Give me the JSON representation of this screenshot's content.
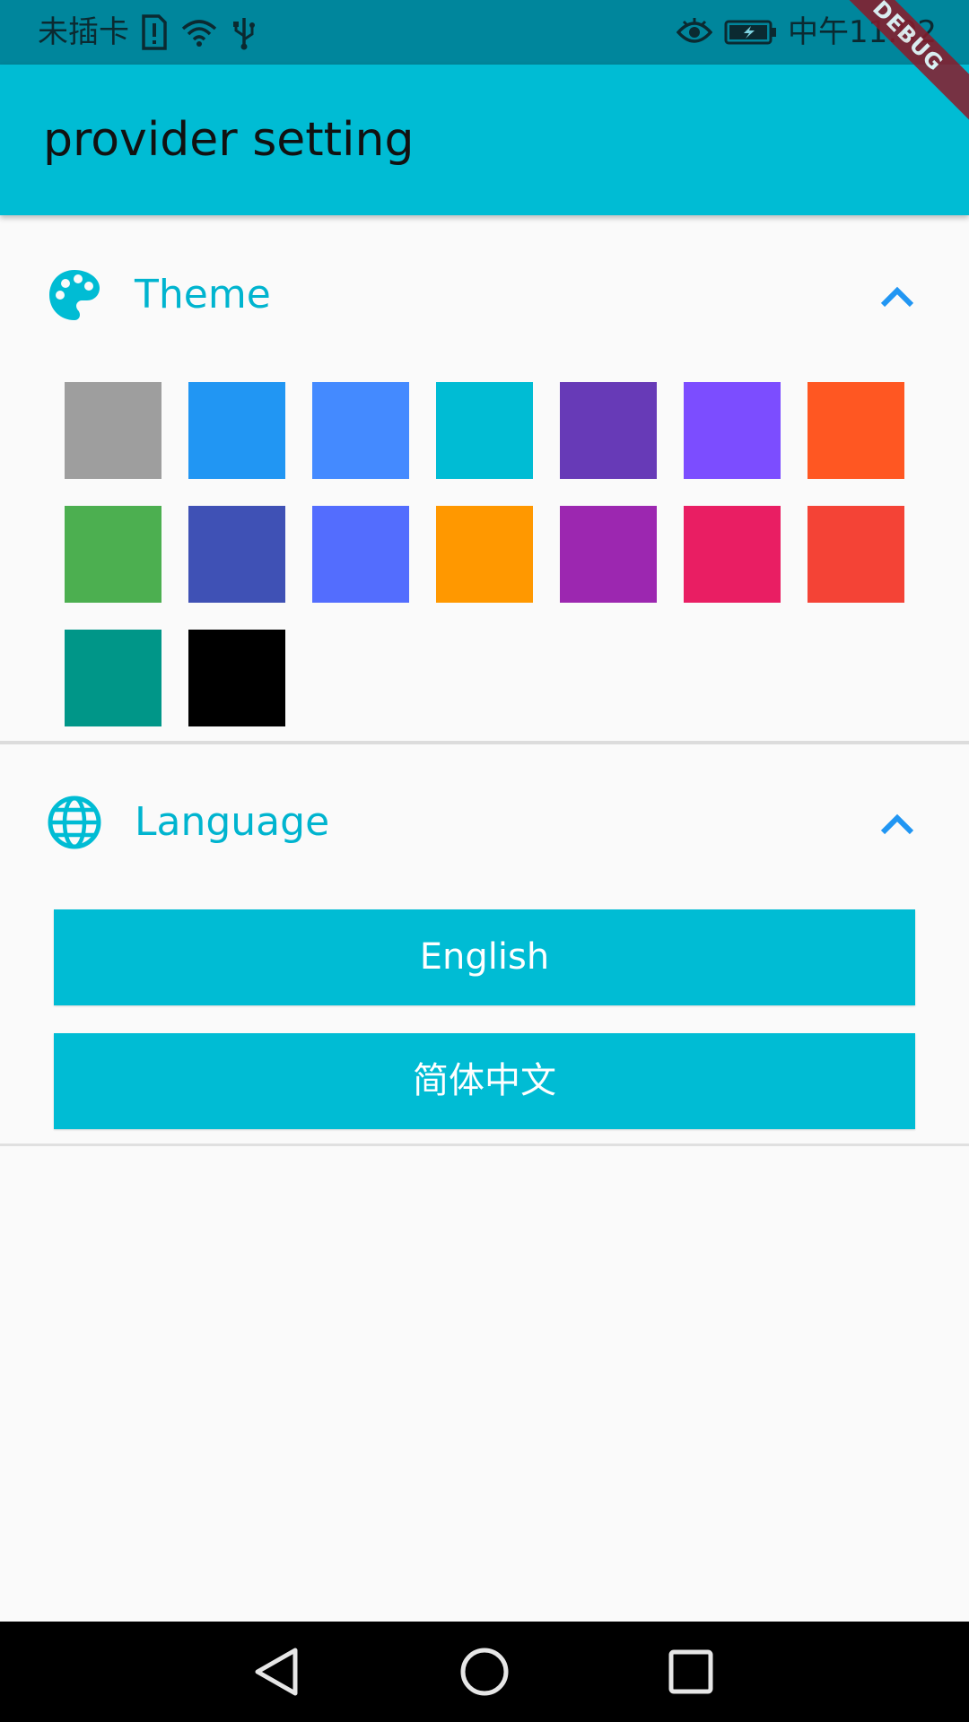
{
  "status_bar": {
    "carrier_text": "未插卡",
    "time_text": "中午11:02",
    "icons": [
      "sim-alert-icon",
      "wifi-icon",
      "usb-icon",
      "eye-icon",
      "battery-charging-icon"
    ]
  },
  "app_bar": {
    "title": "provider setting",
    "debug_label": "DEBUG"
  },
  "theme_section": {
    "title": "Theme",
    "icon": "palette-icon",
    "expanded": true,
    "swatches": [
      "#9e9e9e",
      "#2196f3",
      "#448aff",
      "#00bcd4",
      "#673ab7",
      "#7c4dff",
      "#ff5722",
      "#4caf50",
      "#3f51b5",
      "#536dfe",
      "#ff9800",
      "#9c27b0",
      "#e91e63",
      "#f44336",
      "#009688",
      "#000000"
    ]
  },
  "language_section": {
    "title": "Language",
    "icon": "globe-icon",
    "expanded": true,
    "options": [
      "English",
      "简体中文"
    ]
  },
  "nav_bar": {
    "buttons": [
      "back-icon",
      "home-icon",
      "recents-icon"
    ]
  },
  "colors": {
    "primary": "#00bcd4",
    "status_bar": "#00869c",
    "accent_text": "#00b4cf",
    "chevron": "#2196f3"
  }
}
